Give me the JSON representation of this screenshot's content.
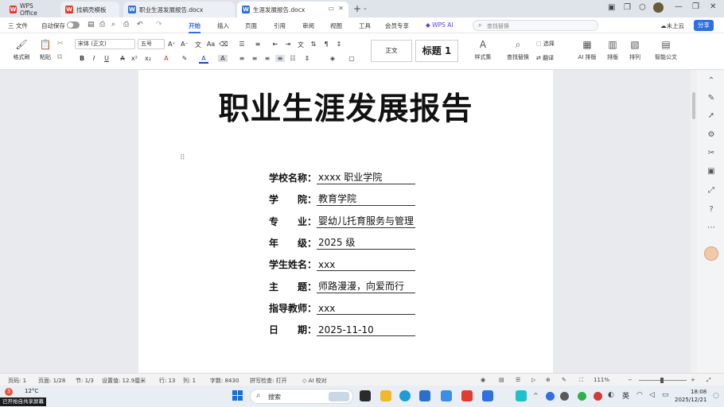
{
  "tabs": [
    {
      "label": "WPS Office",
      "color": "#e23b32"
    },
    {
      "label": "找稿壳模板",
      "color": "#e23b32"
    },
    {
      "label": "职业生涯发展报告.docx",
      "color": "#2f6fe0"
    },
    {
      "label": "生涯发展报告.docx",
      "color": "#2f6fe0"
    }
  ],
  "menu": {
    "file": "三 文件",
    "autosave": "自动保存",
    "items": [
      "开始",
      "插入",
      "页面",
      "引用",
      "审阅",
      "视图",
      "工具",
      "会员专享"
    ],
    "wps_ai": "WPS AI",
    "search_placeholder": "查找替换",
    "cloud": "未上云",
    "share": "分享"
  },
  "ribbon": {
    "format_painter": "格式刷",
    "paste": "粘贴",
    "font": "宋体 (正文)",
    "size": "五号",
    "style_normal": "正文",
    "style_h1": "标题 1",
    "styles_set": "样式集",
    "find_replace": "查找替换",
    "select": "选择",
    "translate": "翻译",
    "ai_layout": "AI 排版",
    "layout": "排版",
    "arrange": "排列",
    "smart_doc": "智能公文"
  },
  "document": {
    "title": "职业生涯发展报告",
    "fields": [
      {
        "label": "学校名称",
        "value": "xxxx 职业学院"
      },
      {
        "label": "学 院",
        "value": "教育学院"
      },
      {
        "label": "专 业",
        "value": "婴幼儿托育服务与管理"
      },
      {
        "label": "年 级",
        "value": "2025 级"
      },
      {
        "label": "学生姓名",
        "value": "xxx"
      },
      {
        "label": "主 题",
        "value": "师路漫漫，向爱而行"
      },
      {
        "label": "指导教师",
        "value": "xxx"
      },
      {
        "label": "日 期",
        "value": "2025-11-10"
      }
    ]
  },
  "status": {
    "page_num": "页码: 1",
    "page": "页面: 1/28",
    "section": "节: 1/3",
    "setting": "设置值: 12.9厘米",
    "line": "行: 13",
    "col": "列: 1",
    "words": "字数: 8430",
    "spell": "拼写检查: 打开",
    "ai": "AI 校对",
    "zoom": "111%"
  },
  "taskbar": {
    "weather": "12°C",
    "search": "搜索",
    "lang": "英",
    "time": "18:08",
    "date": "2025/12/21",
    "share_notice": "已开始自共享屏幕"
  }
}
